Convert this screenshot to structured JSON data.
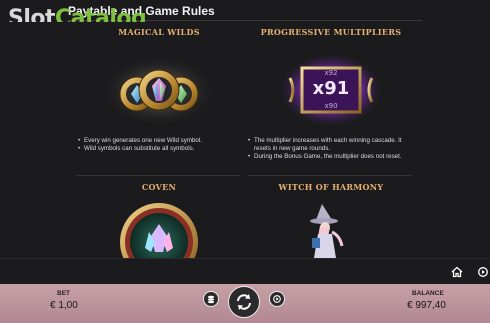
{
  "header": {
    "title": "Paytable and Game Rules"
  },
  "watermark": {
    "part1": "Slot",
    "part2": "Catalog"
  },
  "features": [
    {
      "title": "MAGICAL WILDS",
      "bullets": [
        "Every win generates one new Wild symbol.",
        "Wild symbols can substitute all symbols."
      ]
    },
    {
      "title": "PROGRESSIVE MULTIPLIERS",
      "multiplier_main": "x91",
      "multiplier_top": "x92",
      "multiplier_bottom": "x90",
      "bullets": [
        "The multiplier increases with each winning cascade. It resets in new game rounds.",
        "During the Bonus Game, the multiplier does not reset."
      ]
    },
    {
      "title": "COVEN"
    },
    {
      "title": "WITCH OF HARMONY"
    }
  ],
  "footer": {
    "bet_label": "BET",
    "bet_value": "€ 1,00",
    "balance_label": "BALANCE",
    "balance_value": "€ 997,40"
  },
  "icons": {
    "home": "home-icon",
    "autoplay_top": "autoplay-icon",
    "stake": "stake-icon",
    "spin": "spin-icon",
    "autoplay": "autoplay-icon"
  },
  "colors": {
    "background": "#1b1b1d",
    "feature_title": "#e6b070",
    "footer_bar": "#c7a0a8",
    "watermark_green": "#7fbf3f"
  }
}
